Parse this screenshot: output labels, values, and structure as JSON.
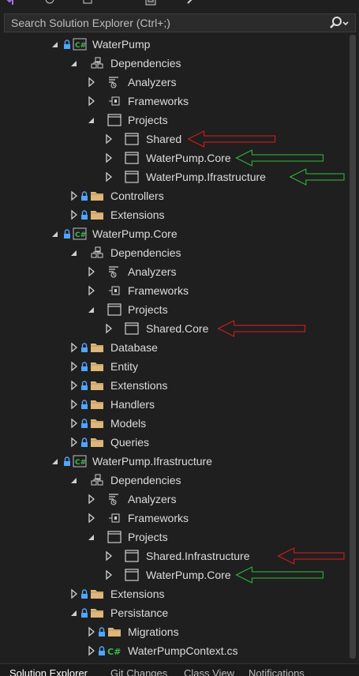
{
  "search": {
    "placeholder": "Search Solution Explorer (Ctrl+;)"
  },
  "tree": [
    {
      "label": "WaterPump",
      "icon": "csharp-project-icon",
      "level": 0,
      "expander": "expanded",
      "lock": true
    },
    {
      "label": "Dependencies",
      "icon": "dependencies-icon",
      "level": 1,
      "expander": "expanded",
      "lock": false
    },
    {
      "label": "Analyzers",
      "icon": "analyzers-icon",
      "level": 2,
      "expander": "collapsed",
      "lock": false
    },
    {
      "label": "Frameworks",
      "icon": "frameworks-icon",
      "level": 2,
      "expander": "collapsed",
      "lock": false
    },
    {
      "label": "Projects",
      "icon": "projects-icon",
      "level": 2,
      "expander": "expanded",
      "lock": false
    },
    {
      "label": "Shared",
      "icon": "project-reference-icon",
      "level": 3,
      "expander": "collapsed",
      "lock": false
    },
    {
      "label": "WaterPump.Core",
      "icon": "project-reference-icon",
      "level": 3,
      "expander": "collapsed",
      "lock": false
    },
    {
      "label": "WaterPump.Ifrastructure",
      "icon": "project-reference-icon",
      "level": 3,
      "expander": "collapsed",
      "lock": false
    },
    {
      "label": "Controllers",
      "icon": "folder-icon",
      "level": 1,
      "expander": "collapsed",
      "lock": true
    },
    {
      "label": "Extensions",
      "icon": "folder-icon",
      "level": 1,
      "expander": "collapsed",
      "lock": true
    },
    {
      "label": "WaterPump.Core",
      "icon": "csharp-project-icon",
      "level": 0,
      "expander": "expanded",
      "lock": true
    },
    {
      "label": "Dependencies",
      "icon": "dependencies-icon",
      "level": 1,
      "expander": "expanded",
      "lock": false
    },
    {
      "label": "Analyzers",
      "icon": "analyzers-icon",
      "level": 2,
      "expander": "collapsed",
      "lock": false
    },
    {
      "label": "Frameworks",
      "icon": "frameworks-icon",
      "level": 2,
      "expander": "collapsed",
      "lock": false
    },
    {
      "label": "Projects",
      "icon": "projects-icon",
      "level": 2,
      "expander": "expanded",
      "lock": false
    },
    {
      "label": "Shared.Core",
      "icon": "project-reference-icon",
      "level": 3,
      "expander": "collapsed",
      "lock": false
    },
    {
      "label": "Database",
      "icon": "folder-icon",
      "level": 1,
      "expander": "collapsed",
      "lock": true
    },
    {
      "label": "Entity",
      "icon": "folder-icon",
      "level": 1,
      "expander": "collapsed",
      "lock": true
    },
    {
      "label": "Extenstions",
      "icon": "folder-icon",
      "level": 1,
      "expander": "collapsed",
      "lock": true
    },
    {
      "label": "Handlers",
      "icon": "folder-icon",
      "level": 1,
      "expander": "collapsed",
      "lock": true
    },
    {
      "label": "Models",
      "icon": "folder-icon",
      "level": 1,
      "expander": "collapsed",
      "lock": true
    },
    {
      "label": "Queries",
      "icon": "folder-icon",
      "level": 1,
      "expander": "collapsed",
      "lock": true
    },
    {
      "label": "WaterPump.Ifrastructure",
      "icon": "csharp-project-icon",
      "level": 0,
      "expander": "expanded",
      "lock": true
    },
    {
      "label": "Dependencies",
      "icon": "dependencies-icon",
      "level": 1,
      "expander": "expanded",
      "lock": false
    },
    {
      "label": "Analyzers",
      "icon": "analyzers-icon",
      "level": 2,
      "expander": "collapsed",
      "lock": false
    },
    {
      "label": "Frameworks",
      "icon": "frameworks-icon",
      "level": 2,
      "expander": "collapsed",
      "lock": false
    },
    {
      "label": "Projects",
      "icon": "projects-icon",
      "level": 2,
      "expander": "expanded",
      "lock": false
    },
    {
      "label": "Shared.Infrastructure",
      "icon": "project-reference-icon",
      "level": 3,
      "expander": "collapsed",
      "lock": false
    },
    {
      "label": "WaterPump.Core",
      "icon": "project-reference-icon",
      "level": 3,
      "expander": "collapsed",
      "lock": false
    },
    {
      "label": "Extensions",
      "icon": "folder-icon",
      "level": 1,
      "expander": "collapsed",
      "lock": true
    },
    {
      "label": "Persistance",
      "icon": "folder-icon",
      "level": 1,
      "expander": "expanded",
      "lock": true
    },
    {
      "label": "Migrations",
      "icon": "folder-icon",
      "level": 2,
      "expander": "collapsed",
      "lock": true
    },
    {
      "label": "WaterPumpContext.cs",
      "icon": "csharp-file-icon",
      "level": 2,
      "expander": "collapsed",
      "lock": true
    }
  ],
  "bottom_tabs": [
    "Solution Explorer",
    "Git Changes",
    "Class View",
    "Notifications"
  ],
  "annotations": [
    {
      "row": 5,
      "color": "#e01b1b"
    },
    {
      "row": 6,
      "color": "#2fbf3a"
    },
    {
      "row": 7,
      "color": "#2fbf3a"
    },
    {
      "row": 15,
      "color": "#e01b1b"
    },
    {
      "row": 27,
      "color": "#e01b1b"
    },
    {
      "row": 28,
      "color": "#2fbf3a"
    }
  ],
  "colors": {
    "background": "#1f1f1f",
    "text": "#dcdcdc",
    "folder": "#dcb67a",
    "csharp": "#3fb950",
    "lock": "#4ea6ff"
  }
}
